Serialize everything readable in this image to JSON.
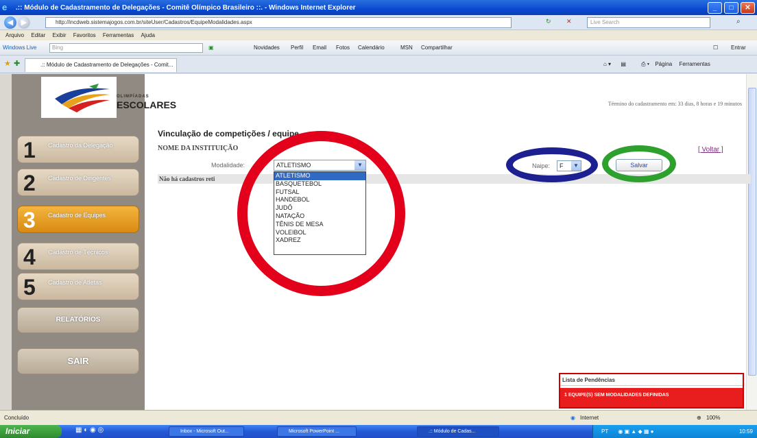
{
  "window": {
    "title": ".:: Módulo de Cadastramento de Delegações - Comitê Olímpico Brasileiro ::. - Windows Internet Explorer",
    "url": "http://incdweb.sistemajogos.com.br/siteUser/Cadastros/EquipeModalidades.aspx",
    "search_placeholder": "Live Search"
  },
  "menu": [
    "Arquivo",
    "Editar",
    "Exibir",
    "Favoritos",
    "Ferramentas",
    "Ajuda"
  ],
  "live_toolbar": {
    "brand": "Windows Live",
    "search_placeholder": "Bing",
    "links": [
      "Novidades",
      "Perfil",
      "Email",
      "Fotos",
      "Calendário",
      "MSN",
      "Compartilhar"
    ],
    "signin": "Entrar"
  },
  "tab": {
    "label": ".:: Módulo de Cadastramento de Delegações - Comit...",
    "commands": [
      "Página",
      "Ferramentas"
    ]
  },
  "brand": {
    "line1": "OLIMPÍADAS",
    "line2": "ESCOLARES"
  },
  "deadline": "Término do cadastramento em: 33 dias, 8 horas e 19 minutos",
  "sidebar": {
    "steps": [
      {
        "num": "1",
        "label": "Cadastro da Delegação"
      },
      {
        "num": "2",
        "label": "Cadastro de Dirigentes"
      },
      {
        "num": "3",
        "label": "Cadastro de Equipes"
      },
      {
        "num": "4",
        "label": "Cadastro de Técnicos"
      },
      {
        "num": "5",
        "label": "Cadastro de Atletas"
      }
    ],
    "relatorios": "RELATÓRIOS",
    "sair": "SAIR"
  },
  "form": {
    "title": "Vinculação de competições / equipe",
    "institution_label": "NOME DA INSTITUIÇÃO",
    "voltar": "[ Voltar ]",
    "modalidade_label": "Modalidade:",
    "modalidade_selected": "ATLETISMO",
    "modalidade_options": [
      "ATLETISMO",
      "BASQUETEBOL",
      "FUTSAL",
      "HANDEBOL",
      "JUDÔ",
      "NATAÇÃO",
      "TÊNIS DE MESA",
      "VOLEIBOL",
      "XADREZ"
    ],
    "naipe_label": "Naipe:",
    "naipe_selected": "F",
    "salvar": "Salvar",
    "no_records": "Não há cadastros reti"
  },
  "pendencias": {
    "title": "Lista de Pendências",
    "item": "1 EQUIPE(S) SEM MODALIDADES DEFINIDAS"
  },
  "statusbar": {
    "left": "Concluído",
    "zone": "Internet",
    "zoom": "100%"
  },
  "taskbar": {
    "start": "Iniciar",
    "tasks": [
      "Inbox - Microsoft Out...",
      "Microsoft PowerPoint ...",
      ".:: Módulo de Cadas..."
    ],
    "tray_lang": "PT",
    "clock": "10:59"
  },
  "colors": {
    "annotation_red": "#e2001a",
    "annotation_blue": "#1c2090",
    "annotation_green": "#2ea02e",
    "active_step": "#f4b53e"
  }
}
